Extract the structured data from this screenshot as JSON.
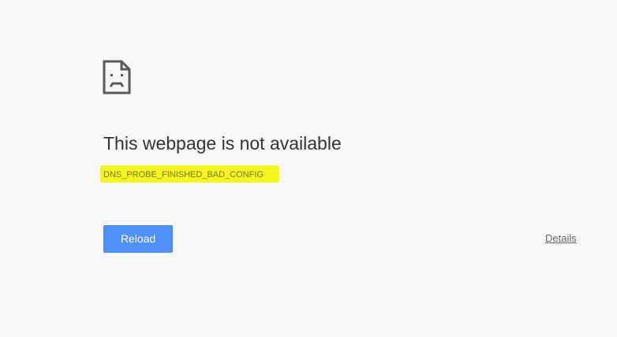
{
  "icons": {
    "error_icon": "sad-document-icon"
  },
  "colors": {
    "background": "#f7f7f7",
    "accent": "#4d90fe",
    "highlight": "#f4f41e",
    "text": "#333333"
  },
  "main": {
    "title": "This webpage is not available",
    "error_code": "DNS_PROBE_FINISHED_BAD_CONFIG"
  },
  "actions": {
    "reload_label": "Reload",
    "details_label": "Details"
  }
}
